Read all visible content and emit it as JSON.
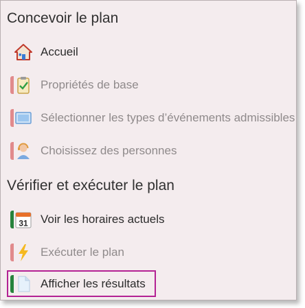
{
  "sections": {
    "design": "Concevoir le plan",
    "verify": "Vérifier et exécuter le plan"
  },
  "items": [
    {
      "label": "Accueil",
      "icon": "home-icon",
      "state": "enabled"
    },
    {
      "label": "Propriétés de base",
      "icon": "clipboard-check-icon",
      "state": "disabled"
    },
    {
      "label": "Sélectionner les types d’événements admissibles",
      "icon": "monitor-icon",
      "state": "disabled"
    },
    {
      "label": "Choisissez des personnes",
      "icon": "person-headset-icon",
      "state": "disabled"
    },
    {
      "label": "Voir les horaires actuels",
      "icon": "calendar-icon",
      "state": "enabled"
    },
    {
      "label": "Exécuter le plan",
      "icon": "lightning-icon",
      "state": "disabled"
    },
    {
      "label": "Afficher les résultats",
      "icon": "document-icon",
      "state": "enabled",
      "highlighted": true
    }
  ],
  "calendar_day": "31",
  "colors": {
    "panel_background": "#f4ecee",
    "disabled_bar": "#e18a8c",
    "enabled_bar": "#27833c",
    "highlight_border": "#b32193"
  }
}
